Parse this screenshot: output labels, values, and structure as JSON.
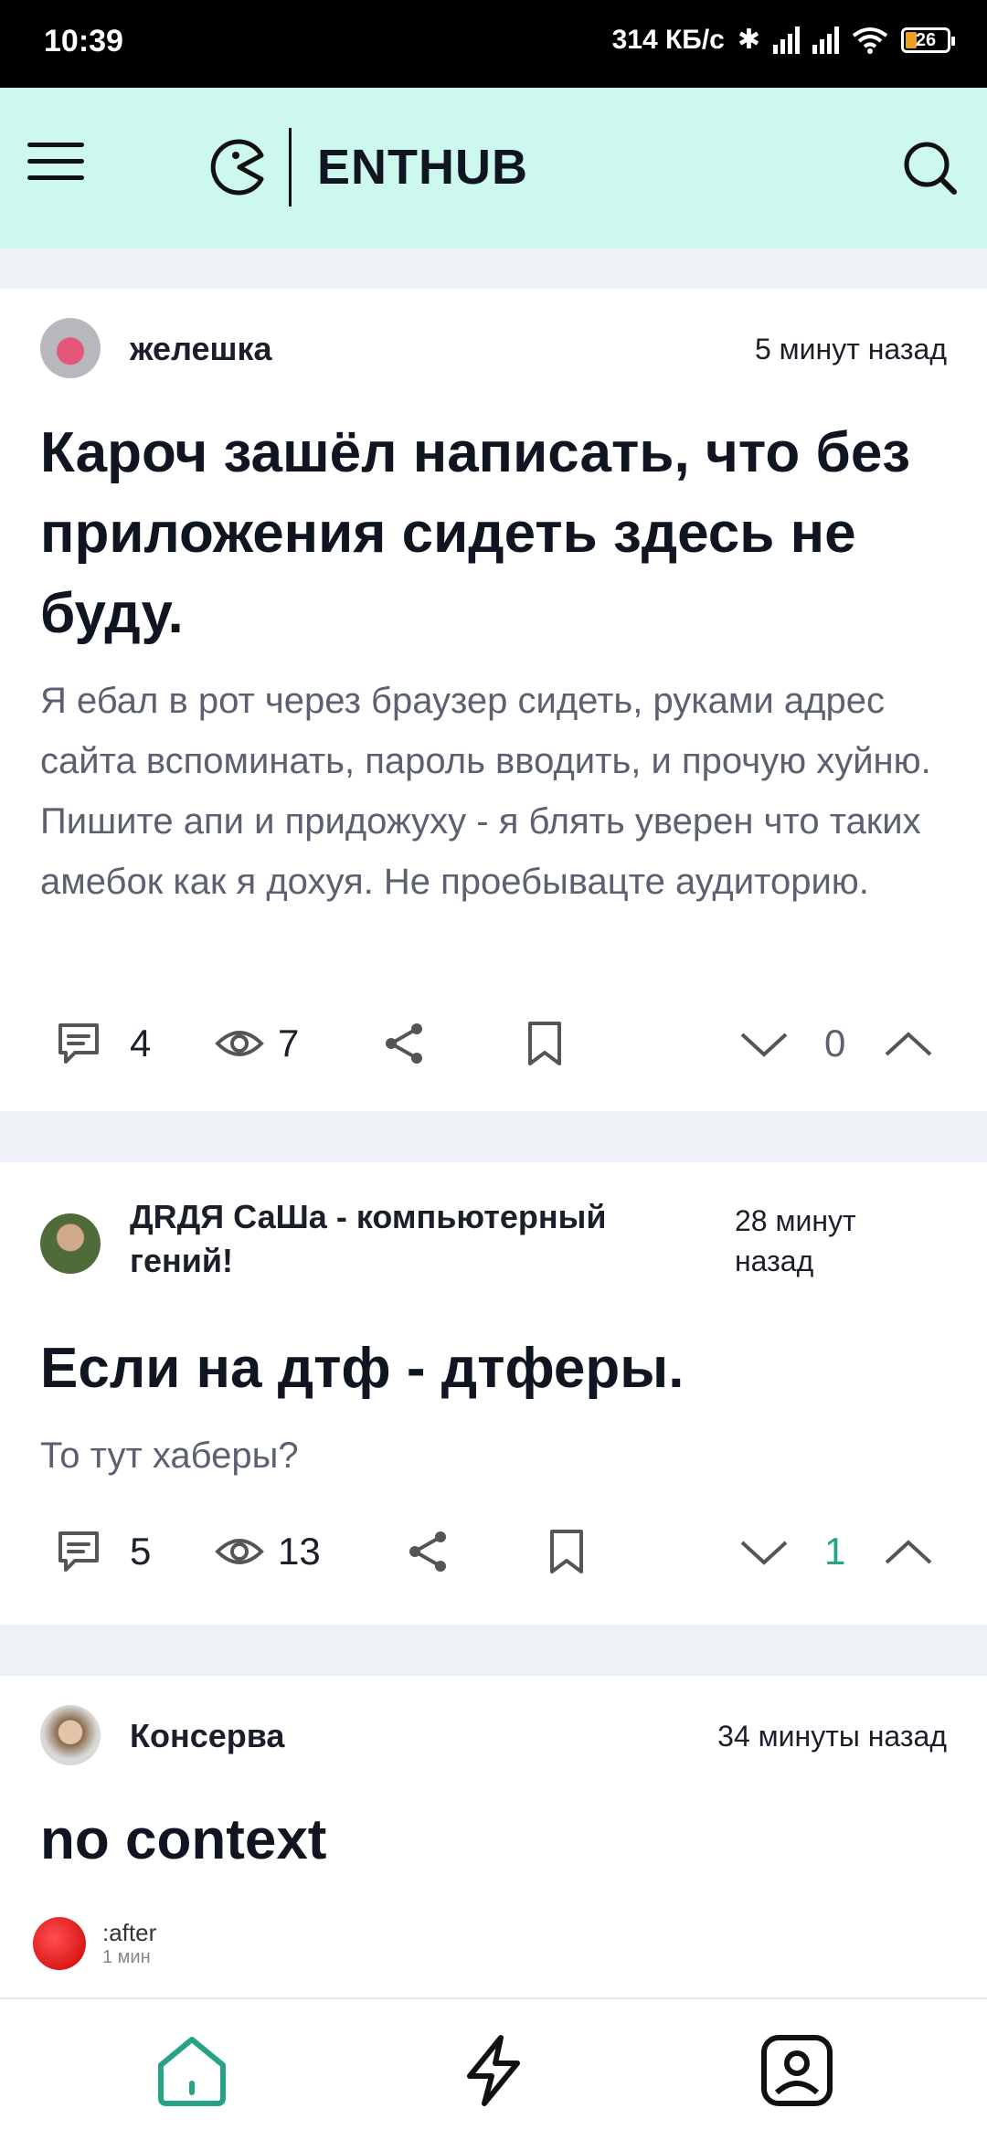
{
  "status_bar": {
    "time": "10:39",
    "speed": "314 КБ/с",
    "battery": "26"
  },
  "header": {
    "brand": "ENTHUB",
    "brand_color": "#cdf8ee"
  },
  "posts": [
    {
      "author": "желешка",
      "time": "5 минут назад",
      "title": "Кароч зашёл написать, что без приложения сидеть здесь не буду.",
      "body": "Я ебал в рот через браузер сидеть, руками адрес сайта вспоминать, пароль вводить, и прочую хуйню. Пишите апи и придожуху - я блять уверен что таких амебок как я дохуя. Не проебывацте аудиторию.",
      "comments": "4",
      "views": "7",
      "score": "0"
    },
    {
      "author": "ДRДЯ СаШа - компьютерный гений!",
      "time": "28 минут назад",
      "title": "Если на дтф - дтферы.",
      "body": "То тут хаберы?",
      "comments": "5",
      "views": "13",
      "score": "1"
    },
    {
      "author": "Консерва",
      "time": "34 минуты назад",
      "title": "no context",
      "peek_name": ":after",
      "peek_meta": "1 мин"
    }
  ],
  "colors": {
    "accent": "#26a384",
    "background": "#eef1f5"
  },
  "icons": [
    "menu-icon",
    "search-icon",
    "comment-icon",
    "eye-icon",
    "share-icon",
    "bookmark-icon",
    "chevron-down-icon",
    "chevron-up-icon",
    "home-icon",
    "lightning-icon",
    "profile-icon"
  ]
}
